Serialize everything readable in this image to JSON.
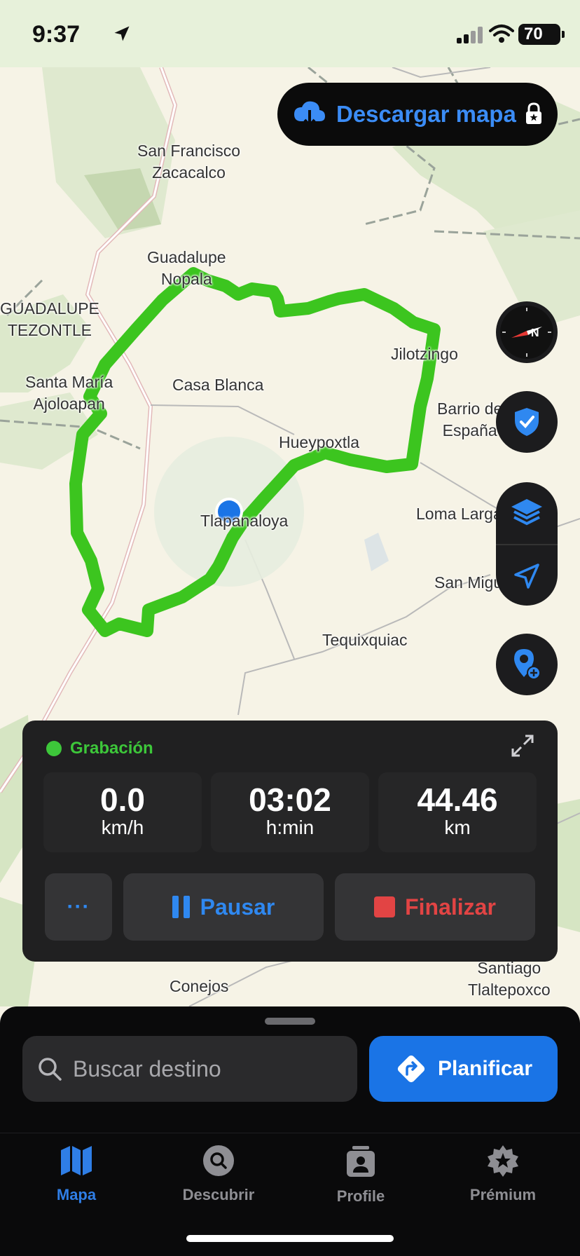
{
  "status_bar": {
    "time": "9:37",
    "battery": "70"
  },
  "map": {
    "labels": [
      "San Francisco\nZacacalco",
      "Guadalupe\nNopala",
      "GUADALUPE\nTEZONTLE",
      "Jilotzingo",
      "Santa María\nAjoloapan",
      "Casa Blanca",
      "Barrio de\nEspaña",
      "Hueypoxtla",
      "Loma Larga",
      "Tlapanaloya",
      "San Miguel",
      "Tequixquiac",
      "Conejos",
      "Santiago\nTlaltepoxco"
    ]
  },
  "download": {
    "label": "Descargar mapa"
  },
  "recording": {
    "status": "Grabación",
    "speed": {
      "value": "0.0",
      "unit": "km/h"
    },
    "time": {
      "value": "03:02",
      "unit": "h:min"
    },
    "distance": {
      "value": "44.46",
      "unit": "km"
    },
    "more_label": "···",
    "pause_label": "Pausar",
    "finish_label": "Finalizar"
  },
  "search": {
    "placeholder": "Buscar destino"
  },
  "plan": {
    "label": "Planificar"
  },
  "tabs": [
    {
      "label": "Mapa",
      "icon": "map-icon",
      "active": true
    },
    {
      "label": "Descubrir",
      "icon": "discover-icon",
      "active": false
    },
    {
      "label": "Profile",
      "icon": "profile-icon",
      "active": false
    },
    {
      "label": "Prémium",
      "icon": "premium-star-icon",
      "active": false
    }
  ],
  "colors": {
    "route": "#3cc51f",
    "accent": "#1a74e6",
    "recording": "#3dc73a",
    "finish": "#e24444"
  }
}
